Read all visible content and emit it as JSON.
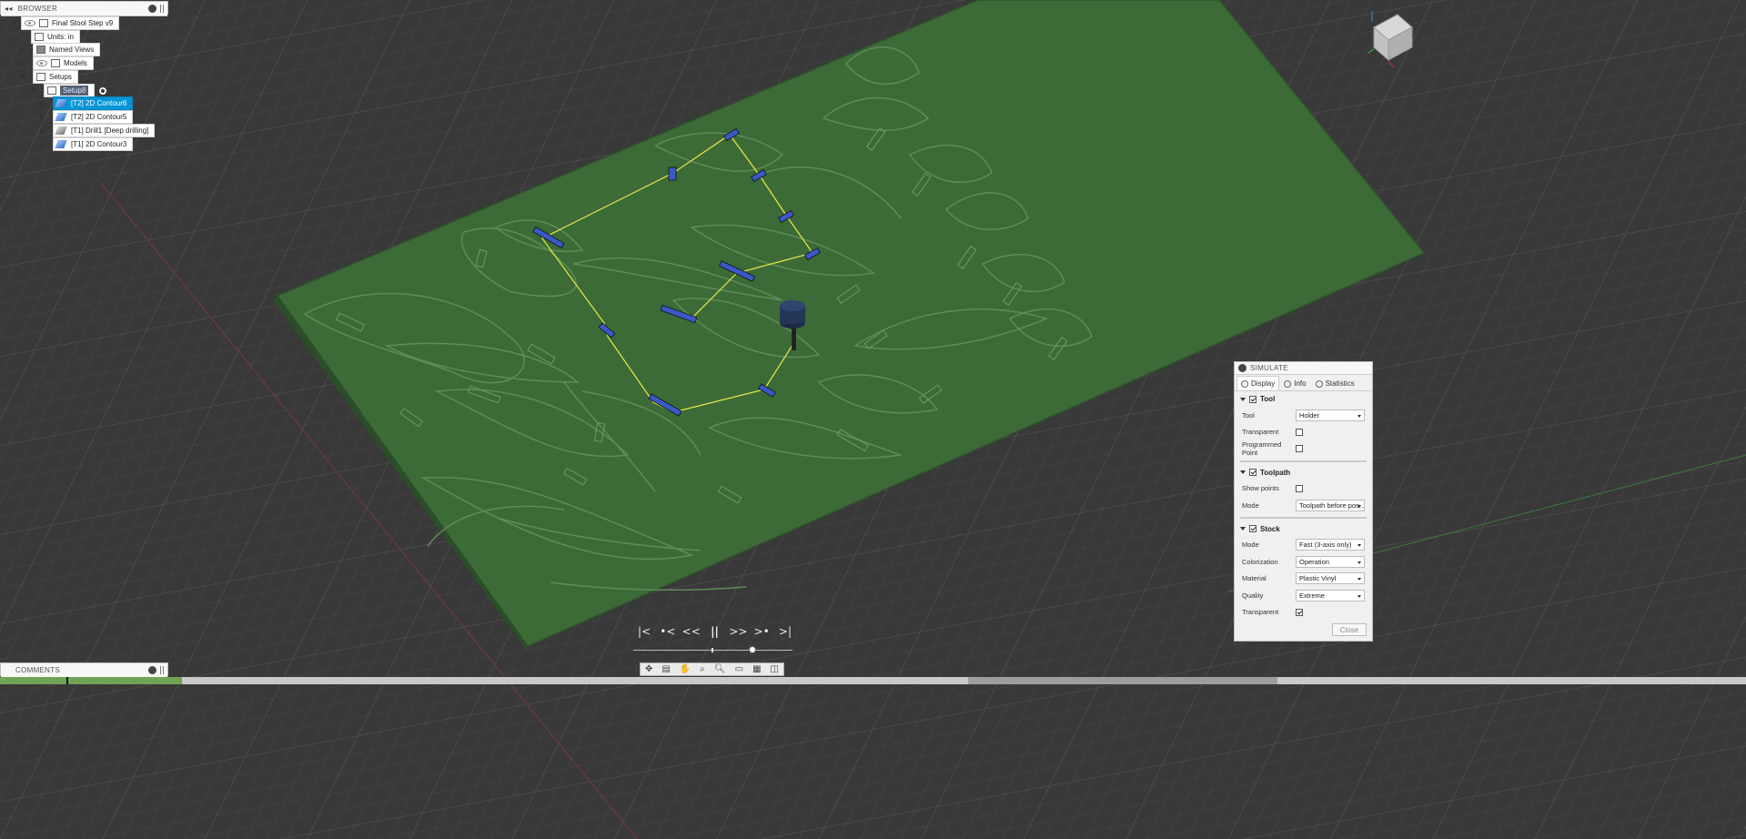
{
  "browser": {
    "title": "BROWSER",
    "root": "Final Stool Step v9",
    "units": "Units: in",
    "named_views": "Named Views",
    "models": "Models",
    "setups": "Setups",
    "setup": "Setup8",
    "operations": [
      {
        "label": "[T2] 2D Contour6",
        "selected": true
      },
      {
        "label": "[T2] 2D Contour5",
        "selected": false
      },
      {
        "label": "[T1] Drill1 [Deep drilling]",
        "selected": false
      },
      {
        "label": "[T1] 2D Contour3",
        "selected": false
      }
    ]
  },
  "comments": {
    "title": "COMMENTS"
  },
  "simulate": {
    "title": "SIMULATE",
    "tabs": [
      "Display",
      "Info",
      "Statistics"
    ],
    "tool_section": "Tool",
    "tool_label": "Tool",
    "tool_value": "Holder",
    "transparent_label": "Transparent",
    "programmed_point_label": "Programmed Point",
    "toolpath_section": "Toolpath",
    "show_points_label": "Show points",
    "mode_label": "Mode",
    "toolpath_mode": "Toolpath before pos...",
    "stock_section": "Stock",
    "stock_mode": "Fast (3-axis only)",
    "colorization_label": "Colorization",
    "colorization_value": "Operation",
    "material_label": "Material",
    "material_value": "Plastic Vinyl",
    "quality_label": "Quality",
    "quality_value": "Extreme",
    "stock_transparent_label": "Transparent",
    "close_label": "Close"
  },
  "playback": {
    "first": "|<",
    "prev_op": "•<",
    "rewind": "<<",
    "pause": "||",
    "forward": ">>",
    "next_op": ">•",
    "last": ">|",
    "progress": 0.75
  },
  "colors": {
    "stock_green": "#3d6b37",
    "toolpath_yellow": "#e8e84a",
    "selection_blue": "#0696d7",
    "background": "#3a3a3a"
  }
}
